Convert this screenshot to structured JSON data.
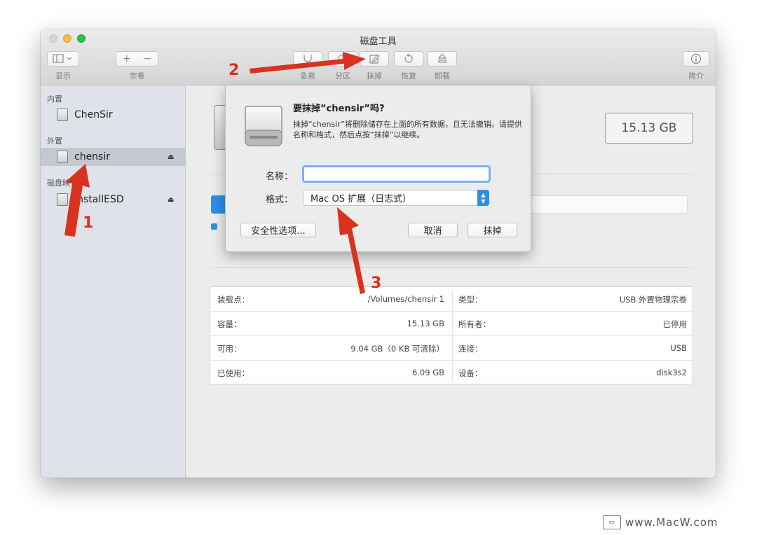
{
  "window": {
    "title": "磁盘工具"
  },
  "toolbar": {
    "view_label": "显示",
    "volume_label": "宗卷",
    "volume_add": "+",
    "volume_remove": "−",
    "firstaid_label": "急救",
    "partition_label": "分区",
    "erase_label": "抹掉",
    "restore_label": "恢复",
    "unmount_label": "卸载",
    "info_label": "简介"
  },
  "sidebar": {
    "sections": [
      {
        "title": "内置"
      },
      {
        "title": "外置"
      },
      {
        "title": "磁盘映"
      }
    ],
    "items": [
      {
        "label": "ChenSir"
      },
      {
        "label": "chensir"
      },
      {
        "label": "InstallESD"
      }
    ],
    "eject": "⏏"
  },
  "main": {
    "capacity": "15.13 GB",
    "info_rows": [
      {
        "k1": "装载点：",
        "v1": "/Volumes/chensir 1",
        "k2": "类型：",
        "v2": "USB 外置物理宗卷"
      },
      {
        "k1": "容量：",
        "v1": "15.13 GB",
        "k2": "所有者：",
        "v2": "已停用"
      },
      {
        "k1": "可用：",
        "v1": "9.04 GB（0 KB 可清除）",
        "k2": "连接：",
        "v2": "USB"
      },
      {
        "k1": "已使用：",
        "v1": "6.09 GB",
        "k2": "设备：",
        "v2": "disk3s2"
      }
    ]
  },
  "dialog": {
    "title": "要抹掉“chensir”吗?",
    "message": "抹掉“chensir”将删除储存在上面的所有数据，且无法撤销。请提供名称和格式，然后点按“抹掉”以继续。",
    "name_label": "名称：",
    "name_value": "",
    "format_label": "格式：",
    "format_value": "Mac OS 扩展（日志式）",
    "security_button": "安全性选项...",
    "cancel_button": "取消",
    "erase_button": "抹掉"
  },
  "annotations": {
    "n1": "1",
    "n2": "2",
    "n3": "3",
    "accent": "#d9321f"
  },
  "watermark": {
    "text": "www.MacW.com"
  }
}
